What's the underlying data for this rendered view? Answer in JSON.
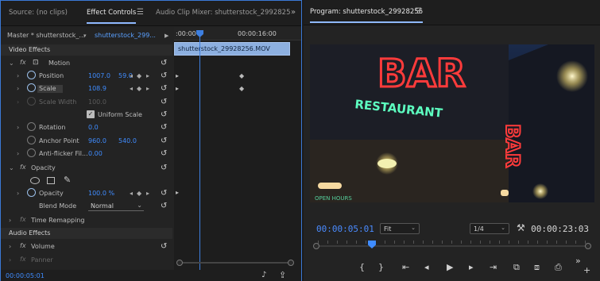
{
  "left_panel": {
    "tabs": [
      {
        "label": "Source: (no clips)"
      },
      {
        "label": "Effect Controls"
      },
      {
        "label": "Audio Clip Mixer: shutterstock_2992825"
      }
    ],
    "menu_icon": "hamburger-menu-icon",
    "overflow_icon": "double-chevron-right-icon",
    "master_label": "Master * shutterstock_...",
    "clip_label": "shutterstock_299...",
    "sections": {
      "video_effects": "Video Effects",
      "audio_effects": "Audio Effects"
    },
    "motion": {
      "label": "Motion",
      "properties": [
        {
          "label": "Position",
          "v1": "1007.0",
          "v2": "59.0"
        },
        {
          "label": "Scale",
          "v1": "108.9",
          "v2": ""
        },
        {
          "label": "Scale Width",
          "v1": "100.0",
          "v2": ""
        },
        {
          "label": "Uniform Scale",
          "v1": "",
          "v2": ""
        },
        {
          "label": "Rotation",
          "v1": "0.0",
          "v2": ""
        },
        {
          "label": "Anchor Point",
          "v1": "960.0",
          "v2": "540.0"
        },
        {
          "label": "Anti-flicker Fil...",
          "v1": "0.00",
          "v2": ""
        }
      ]
    },
    "opacity": {
      "label": "Opacity",
      "value_label": "Opacity",
      "value": "100.0 %",
      "blend_label": "Blend Mode",
      "blend_value": "Normal"
    },
    "time_remapping": "Time Remapping",
    "audio": {
      "volume": "Volume",
      "panner": "Panner"
    },
    "timeline": {
      "ruler_start": ":00:00",
      "ruler_end": "00:00:16:00",
      "clip_name": "shutterstock_29928256.MOV"
    },
    "footer_timecode": "00:00:05:01"
  },
  "right_panel": {
    "title": "Program: shutterstock_29928256",
    "menu_icon": "hamburger-menu-icon",
    "timecode_current": "00:00:05:01",
    "fit_label": "Fit",
    "resolution_label": "1/4",
    "timecode_duration": "00:00:23:03",
    "video_text": {
      "bar_big": "BAR",
      "restaurant": "RESTAURANT",
      "bar_side": "BAR",
      "small_sign": "OPEN HOURS"
    }
  },
  "colors": {
    "accent_blue": "#3f8cff",
    "neon_red": "#ff3b3b",
    "neon_green": "#4dffb0"
  }
}
